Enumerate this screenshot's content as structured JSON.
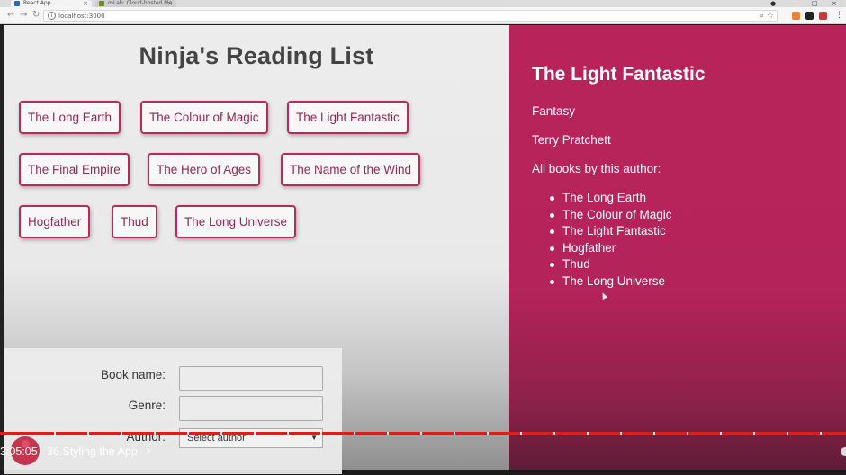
{
  "browser": {
    "tabs": [
      {
        "title": "React App",
        "active": true
      },
      {
        "title": "mLab: Cloud-hosted Mo",
        "active": false
      }
    ],
    "url": "localhost:3000"
  },
  "page": {
    "title": "Ninja's Reading List",
    "books": [
      "The Long Earth",
      "The Colour of Magic",
      "The Light Fantastic",
      "The Final Empire",
      "The Hero of Ages",
      "The Name of the Wind",
      "Hogfather",
      "Thud",
      "The Long Universe"
    ],
    "form": {
      "book_name_label": "Book name:",
      "genre_label": "Genre:",
      "author_label": "Author:",
      "author_select": "Select author"
    }
  },
  "details": {
    "title": "The Light Fantastic",
    "genre": "Fantasy",
    "author": "Terry Pratchett",
    "all_books_label": "All books by this author:",
    "author_books": [
      "The Long Earth",
      "The Colour of Magic",
      "The Light Fantastic",
      "Hogfather",
      "Thud",
      "The Long Universe"
    ]
  },
  "video": {
    "time": "3:05:05",
    "chapter": "36.Styling the App",
    "accent": "#e01c1c"
  },
  "colors": {
    "accent": "#b8245a",
    "button_border": "#b9295a",
    "button_text": "#8e2a50"
  }
}
